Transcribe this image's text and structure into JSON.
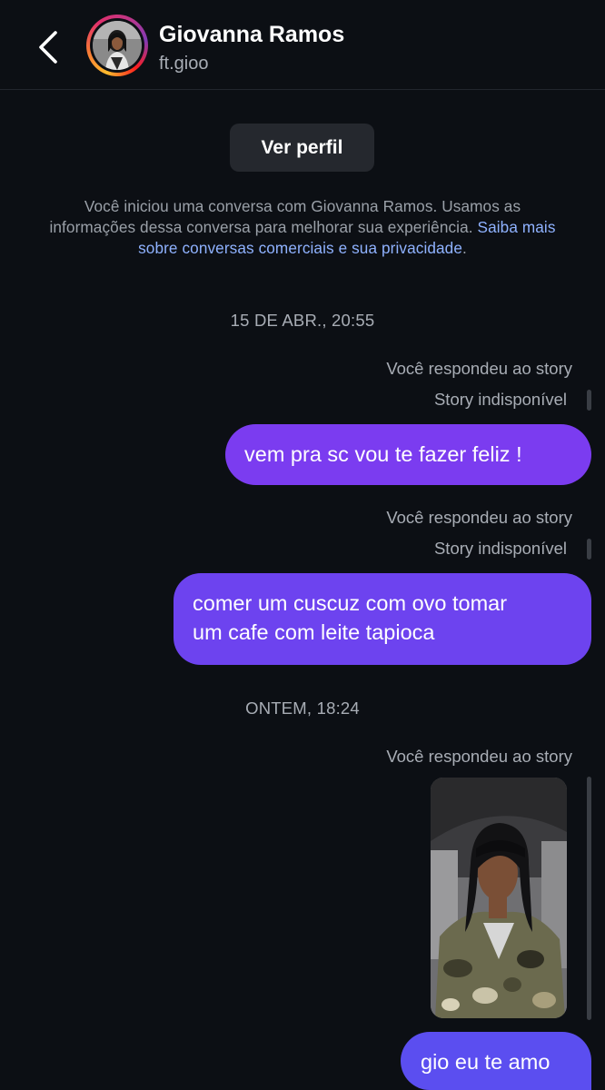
{
  "header": {
    "contact_name": "Giovanna Ramos",
    "username": "ft.gioo",
    "back_icon": "chevron-left-icon"
  },
  "profile_button": {
    "label": "Ver perfil"
  },
  "notice": {
    "line1": "Você iniciou uma conversa com Giovanna Ramos. Usamos as",
    "line2_text": "informações dessa conversa para melhorar sua experiência. ",
    "line2_link": "Saiba mais",
    "line3_link": "sobre conversas comerciais e sua privacidade",
    "line3_end": "."
  },
  "messages": [
    {
      "timestamp": "15 DE ABR., 20:55",
      "reply_label": "Você respondeu ao story",
      "story_status": "Story indisponível",
      "text": "vem pra sc vou te fazer feliz !"
    },
    {
      "reply_label": "Você respondeu ao story",
      "story_status": "Story indisponível",
      "text_line1": "comer um cuscuz com ovo tomar",
      "text_line2": "um cafe com leite tapioca"
    },
    {
      "timestamp": "ONTEM, 18:24",
      "reply_label": "Você respondeu ao story",
      "text": "gio eu te amo"
    }
  ],
  "colors": {
    "background": "#0c0f14",
    "bubble_purple": "#7b3cf0",
    "bubble_violet": "#6d43ef",
    "bubble_blue_violet": "#5b4ef0",
    "link": "#8fb2ff",
    "muted_text": "#a8adb5"
  }
}
